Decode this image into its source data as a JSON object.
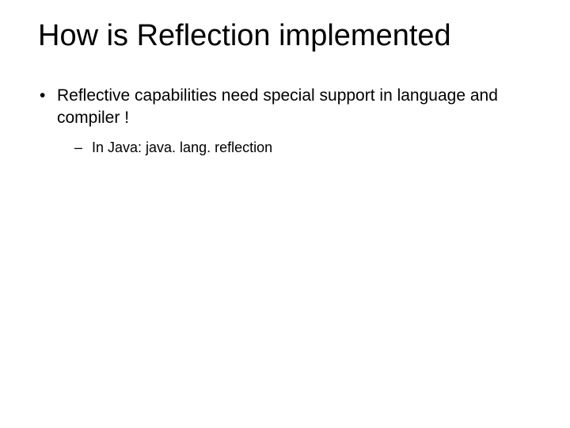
{
  "title": "How is Reflection implemented",
  "bullets": [
    {
      "text": "Reflective capabilities need special support in language and compiler !",
      "sub": [
        {
          "text": "In Java: java. lang. reflection"
        }
      ]
    }
  ]
}
